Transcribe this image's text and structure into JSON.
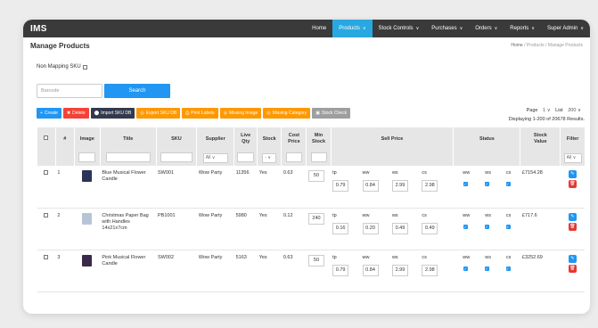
{
  "brand": "IMS",
  "nav": [
    {
      "label": "Home",
      "active": false,
      "caret": false
    },
    {
      "label": "Products",
      "active": true,
      "caret": true
    },
    {
      "label": "Stock Controls",
      "active": false,
      "caret": true
    },
    {
      "label": "Purchases",
      "active": false,
      "caret": true
    },
    {
      "label": "Orders",
      "active": false,
      "caret": true
    },
    {
      "label": "Reports",
      "active": false,
      "caret": true
    },
    {
      "label": "Super Admin",
      "active": false,
      "caret": true
    }
  ],
  "page_title": "Manage Products",
  "breadcrumb": {
    "home": "Home",
    "sep": " / ",
    "section": "Products",
    "current": "Manage Products"
  },
  "non_mapping_label": "Non Mapping SKU",
  "barcode_placeholder": "Barcode",
  "search_label": "Search",
  "toolbar": [
    {
      "label": "Create",
      "icon": "+",
      "color": "#2196f3",
      "name": "create-button"
    },
    {
      "label": "Delete",
      "icon": "✖",
      "color": "#f44336",
      "name": "delete-button"
    },
    {
      "label": "Import SKU DB",
      "icon": "⬤",
      "color": "#333a4d",
      "name": "import-sku-db-button"
    },
    {
      "label": "Export SKU DB",
      "icon": "◎",
      "color": "#ff9800",
      "name": "export-sku-db-button"
    },
    {
      "label": "Print Labels",
      "icon": "⎙",
      "color": "#ff9800",
      "name": "print-labels-button"
    },
    {
      "label": "Missing Image",
      "icon": "◎",
      "color": "#ff9800",
      "name": "missing-image-button"
    },
    {
      "label": "Missing Category",
      "icon": "◎",
      "color": "#ff9800",
      "name": "missing-category-button"
    },
    {
      "label": "Stock Check",
      "icon": "▣",
      "color": "#9e9e9e",
      "name": "stock-check-button"
    }
  ],
  "pager": {
    "page_label": "Page",
    "page_value": "1",
    "list_label": "List",
    "list_value": "200",
    "displaying": "Displaying 1-200 of 20678 Results."
  },
  "columns": {
    "hash": "#",
    "image": "Image",
    "title": "Title",
    "sku": "SKU",
    "supplier": "Supplier",
    "live_qty_1": "Live",
    "live_qty_2": "Qty",
    "stock": "Stock",
    "cost_1": "Cost",
    "cost_2": "Price",
    "min_1": "Min",
    "min_2": "Stock",
    "sell_price": "Sell Price",
    "status": "Status",
    "stock_value_1": "Stock",
    "stock_value_2": "Value",
    "filter": "Filter"
  },
  "filters": {
    "supplier": "All",
    "stock": "- ∨",
    "filter": "All"
  },
  "price_headers": [
    "tp",
    "ww",
    "ws",
    "cs"
  ],
  "status_headers": [
    "ww",
    "ws",
    "cs"
  ],
  "products": [
    {
      "num": "1",
      "title": "Blue Musical Flower Candle",
      "sku": "SW001",
      "supplier": "Wow Party",
      "live_qty": "11356",
      "stock": "Yes",
      "cost": "0.63",
      "min_stock": "50",
      "prices": [
        "0.79",
        "0.84",
        "2.99",
        "2.98"
      ],
      "stock_value": "£7154.28",
      "thumb": "#2a3358"
    },
    {
      "num": "2",
      "title": "Christmas Paper Bag with Handles 14x21x7cm",
      "sku": "PB1001",
      "supplier": "Wow Party",
      "live_qty": "5980",
      "stock": "Yes",
      "cost": "0.12",
      "min_stock": "240",
      "prices": [
        "0.16",
        "0.20",
        "0.49",
        "0.49"
      ],
      "stock_value": "£717.6",
      "thumb": "#b7c4d8"
    },
    {
      "num": "3",
      "title": "Pink Musical Flower Candle",
      "sku": "SW002",
      "supplier": "Wow Party",
      "live_qty": "5163",
      "stock": "Yes",
      "cost": "0.63",
      "min_stock": "50",
      "prices": [
        "0.79",
        "0.84",
        "2.99",
        "2.98"
      ],
      "stock_value": "£3252.69",
      "thumb": "#3a2a4a"
    }
  ],
  "colors": {
    "accent": "#29a8e0",
    "edit": "#2196f3",
    "delete": "#e53935",
    "topbar": "#3a3a3a"
  }
}
